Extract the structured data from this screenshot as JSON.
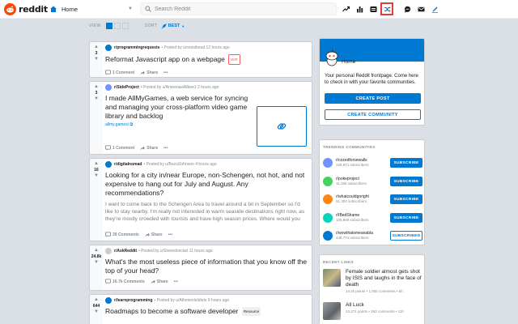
{
  "header": {
    "logo_text": "reddit",
    "home_label": "Home",
    "search_placeholder": "Search Reddit"
  },
  "sortbar": {
    "view_label": "VIEW",
    "sort_label": "SORT",
    "sort_value": "BEST"
  },
  "posts": [
    {
      "score": "3",
      "subreddit": "r/programmingrequests",
      "meta": "• Posted by u/ozesiboud 12 hours ago",
      "title": "Reformat Javascript app on a webpage",
      "flair": "WIP",
      "comments": "1 Comment",
      "share": "Share",
      "more": "•••"
    },
    {
      "score": "3",
      "subreddit": "r/SideProject",
      "meta": "• Posted by u/AmeenasAllbee1 2 hours ago",
      "title": "I made AllMyGames, a web service for syncing and managing your cross-platform video game library and backlog",
      "link": "allmy.games/ ⧉",
      "comments": "1 Comment",
      "share": "Share",
      "more": "•••"
    },
    {
      "score": "16",
      "subreddit": "r/digitalnomad",
      "meta": "• Posted by u/BezulJohnson 4 hours ago",
      "title": "Looking for a city in/near Europe, non-Schengen, not hot, and not expensive to hang out for July and August. Any recommendations?",
      "preview": "I want to come back to the Schengen Area to travel around a bit in September so I'd like to stay nearby. I'm really not interested in warm seaside destinations right now, as they're mostly crowded with tourists and have high season prices. Where would you",
      "comments": "39 Comments",
      "share": "Share",
      "more": "•••"
    },
    {
      "score": "24.8k",
      "subreddit": "r/AskReddit",
      "meta": "• Posted by u/Stonedonckel 11 hours ago",
      "title": "What's the most useless piece of information that you know off the top of your head?",
      "comments": "16.7k Comments",
      "share": "Share",
      "more": "•••"
    },
    {
      "score": "644",
      "subreddit": "r/learnprogramming",
      "meta": "• Posted by u/AtheismIsIdiots 9 hours ago",
      "title": "Roadmaps to become a software developer",
      "flair": "Resource"
    }
  ],
  "home_card": {
    "title": "Home",
    "description": "Your personal Reddit frontpage. Come here to check in with your favorite communities.",
    "create_post": "CREATE POST",
    "create_community": "CREATE COMMUNITY"
  },
  "trending": {
    "header": "TRENDING COMMUNITIES",
    "items": [
      {
        "name": "r/cozedforsewalls",
        "subs": "128,971 subscribers",
        "button": "SUBSCRIBE",
        "color": "#7193ff"
      },
      {
        "name": "r/pokeproject",
        "subs": "11,195 subscribers",
        "button": "SUBSCRIBE",
        "color": "#46d160"
      },
      {
        "name": "r/whatcouldgoright",
        "subs": "51,304 subscribers",
        "button": "SUBSCRIBE",
        "color": "#ff8717"
      },
      {
        "name": "r/IBedShame",
        "subs": "105,880 subscribers",
        "button": "SUBSCRIBE",
        "color": "#0dd3bb"
      },
      {
        "name": "r/wowthatsmeanabla",
        "subs": "446,774 subscribers",
        "button": "SUBSCRIBED",
        "color": "#0079d3"
      }
    ]
  },
  "recent": {
    "header": "RECENT LINKS",
    "items": [
      {
        "title": "Female soldier almost gets shot by ISIS and laughs in the face of death",
        "meta": "14.2k points • 1,005 comments • 6h"
      },
      {
        "title": "All Luck",
        "meta": "13,271 points • 263 comments • 11h"
      }
    ]
  }
}
